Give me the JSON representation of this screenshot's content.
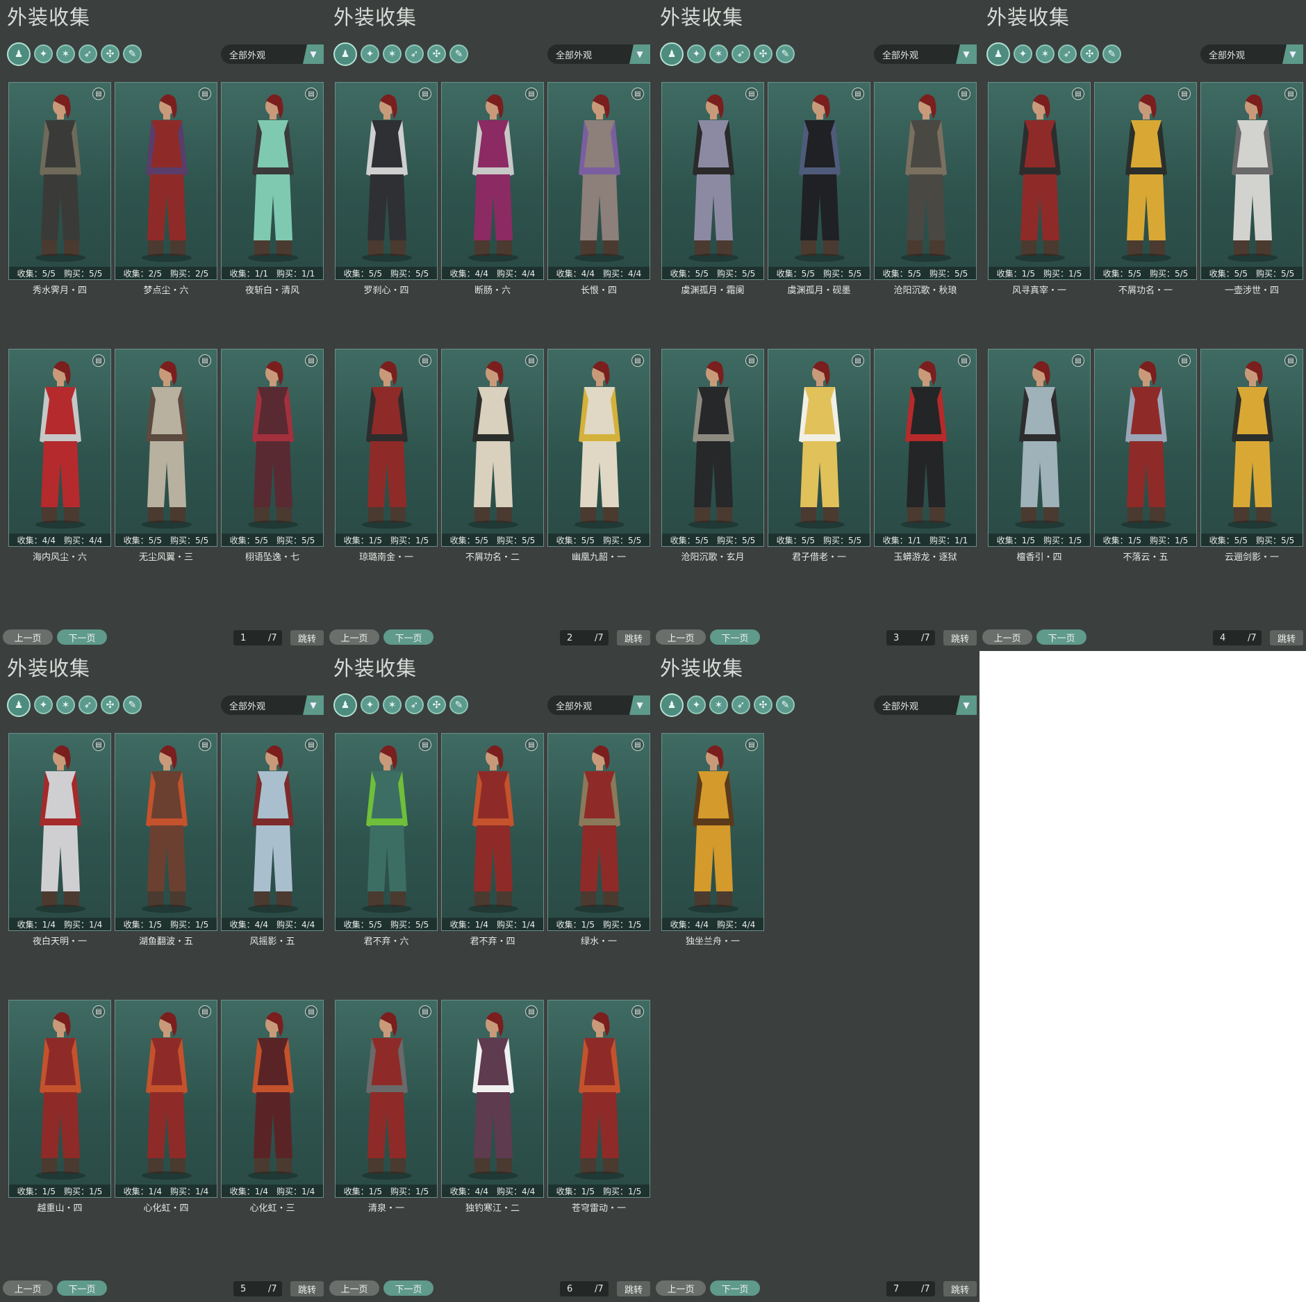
{
  "ui": {
    "title": "外装收集",
    "filter_label": "全部外观",
    "prev_label": "上一页",
    "next_label": "下一页",
    "jump_label": "跳转",
    "total_suffix": "/7",
    "toolbar_icons": [
      "outfit-all-icon",
      "top-icon",
      "armor-icon",
      "boots-icon",
      "mask-icon",
      "cape-icon"
    ],
    "accent": "#5d9a8a"
  },
  "pages": [
    {
      "page": "1",
      "items": [
        {
          "name": "秀水霁月・四",
          "stats": "收集：5/5　购买：5/5",
          "outfit": "#3a3b38",
          "trim": "#6f6a5a"
        },
        {
          "name": "梦点尘・六",
          "stats": "收集：2/5　购买：2/5",
          "outfit": "#8e2b28",
          "trim": "#5a3d6a"
        },
        {
          "name": "夜斩白・清风",
          "stats": "收集：1/1　购买：1/1",
          "outfit": "#7fc9b1",
          "trim": "#3a3a3a"
        },
        {
          "name": "海内风尘・六",
          "stats": "收集：4/4　购买：4/4",
          "outfit": "#b52a2d",
          "trim": "#c7c7c7"
        },
        {
          "name": "无尘风翼・三",
          "stats": "收集：5/5　购买：5/5",
          "outfit": "#b8b1a0",
          "trim": "#5b4a3f"
        },
        {
          "name": "栩语坠逸・七",
          "stats": "收集：5/5　购买：5/5",
          "outfit": "#5a2a32",
          "trim": "#a3313d"
        }
      ]
    },
    {
      "page": "2",
      "items": [
        {
          "name": "罗刹心・四",
          "stats": "收集：5/5　购买：5/5",
          "outfit": "#2f3033",
          "trim": "#cfcfcf"
        },
        {
          "name": "断肠・六",
          "stats": "收集：4/4　购买：4/4",
          "outfit": "#8c2a63",
          "trim": "#c8c8c8"
        },
        {
          "name": "长恨・四",
          "stats": "收集：4/4　购买：4/4",
          "outfit": "#8d7f7a",
          "trim": "#7a5ea0"
        },
        {
          "name": "琼璐南金・一",
          "stats": "收集：1/5　购买：1/5",
          "outfit": "#8e2b28",
          "trim": "#2d2d2d"
        },
        {
          "name": "不屑功名・二",
          "stats": "收集：5/5　购买：5/5",
          "outfit": "#d9d0bd",
          "trim": "#2b2f2c"
        },
        {
          "name": "幽凰九韶・一",
          "stats": "收集：5/5　购买：5/5",
          "outfit": "#e0d8c4",
          "trim": "#d4b13a"
        }
      ]
    },
    {
      "page": "3",
      "items": [
        {
          "name": "虞渊孤月・霜阑",
          "stats": "收集：5/5　购买：5/5",
          "outfit": "#8c8aa3",
          "trim": "#2a2a2a"
        },
        {
          "name": "虞渊孤月・砚墨",
          "stats": "收集：5/5　购买：5/5",
          "outfit": "#1f2124",
          "trim": "#4f5b7a"
        },
        {
          "name": "沧阳沉歌・秋琅",
          "stats": "收集：5/5　购买：5/5",
          "outfit": "#4a4843",
          "trim": "#7a7060"
        },
        {
          "name": "沧阳沉歌・玄月",
          "stats": "收集：5/5　购买：5/5",
          "outfit": "#26282a",
          "trim": "#8d8a80"
        },
        {
          "name": "君子借老・一",
          "stats": "收集：5/5　购买：5/5",
          "outfit": "#e1c15a",
          "trim": "#f2efe4"
        },
        {
          "name": "玉蟒游龙・逐狱",
          "stats": "收集：1/1　购买：1/1",
          "outfit": "#242527",
          "trim": "#b72a2a"
        }
      ]
    },
    {
      "page": "4",
      "items": [
        {
          "name": "风寻真宰・一",
          "stats": "收集：1/5　购买：1/5",
          "outfit": "#8e2b28",
          "trim": "#2d2d2d"
        },
        {
          "name": "不屑功名・一",
          "stats": "收集：5/5　购买：5/5",
          "outfit": "#d9a834",
          "trim": "#2b2f2c"
        },
        {
          "name": "一壶涉世・四",
          "stats": "收集：5/5　购买：5/5",
          "outfit": "#d2d2cf",
          "trim": "#6a6a6a"
        },
        {
          "name": "檀香引・四",
          "stats": "收集：1/5　购买：1/5",
          "outfit": "#9fb1b9",
          "trim": "#2d2d2d"
        },
        {
          "name": "不落云・五",
          "stats": "收集：1/5　购买：1/5",
          "outfit": "#8e2b28",
          "trim": "#9aa6b8"
        },
        {
          "name": "云逦剑影・一",
          "stats": "收集：5/5　购买：5/5",
          "outfit": "#d9a834",
          "trim": "#2b2f2c"
        }
      ]
    },
    {
      "page": "5",
      "items": [
        {
          "name": "夜白天明・一",
          "stats": "收集：1/4　购买：1/4",
          "outfit": "#cfcfd2",
          "trim": "#a52a2a"
        },
        {
          "name": "湖鱼翻波・五",
          "stats": "收集：1/5　购买：1/5",
          "outfit": "#6b4030",
          "trim": "#c4522c"
        },
        {
          "name": "风摇影・五",
          "stats": "收集：4/4　购买：4/4",
          "outfit": "#a9bfce",
          "trim": "#7d2a2a"
        },
        {
          "name": "越重山・四",
          "stats": "收集：1/5　购买：1/5",
          "outfit": "#8e2b28",
          "trim": "#c4522c"
        },
        {
          "name": "心化虹・四",
          "stats": "收集：1/4　购买：1/4",
          "outfit": "#8e2b28",
          "trim": "#c4522c"
        },
        {
          "name": "心化虹・三",
          "stats": "收集：1/4　购买：1/4",
          "outfit": "#5a2426",
          "trim": "#c4522c"
        }
      ]
    },
    {
      "page": "6",
      "items": [
        {
          "name": "君不弃・六",
          "stats": "收集：5/5　购买：5/5",
          "outfit": "#3d6e63",
          "trim": "#6fbf3a"
        },
        {
          "name": "君不弃・四",
          "stats": "收集：1/4　购买：1/4",
          "outfit": "#8e2b28",
          "trim": "#c4522c"
        },
        {
          "name": "绿水・一",
          "stats": "收集：1/5　购买：1/5",
          "outfit": "#8e2b28",
          "trim": "#8a7a5a"
        },
        {
          "name": "清泉・一",
          "stats": "收集：1/5　购买：1/5",
          "outfit": "#8e2b28",
          "trim": "#6a6a6a"
        },
        {
          "name": "独钓寒江・二",
          "stats": "收集：4/4　购买：4/4",
          "outfit": "#5e3b4e",
          "trim": "#f0f0f0"
        },
        {
          "name": "苍穹雷动・一",
          "stats": "收集：1/5　购买：1/5",
          "outfit": "#8e2b28",
          "trim": "#c4522c"
        }
      ]
    },
    {
      "page": "7",
      "items": [
        {
          "name": "独坐兰舟・一",
          "stats": "收集：4/4　购买：4/4",
          "outfit": "#d49a2c",
          "trim": "#5a3a1a"
        }
      ]
    }
  ]
}
